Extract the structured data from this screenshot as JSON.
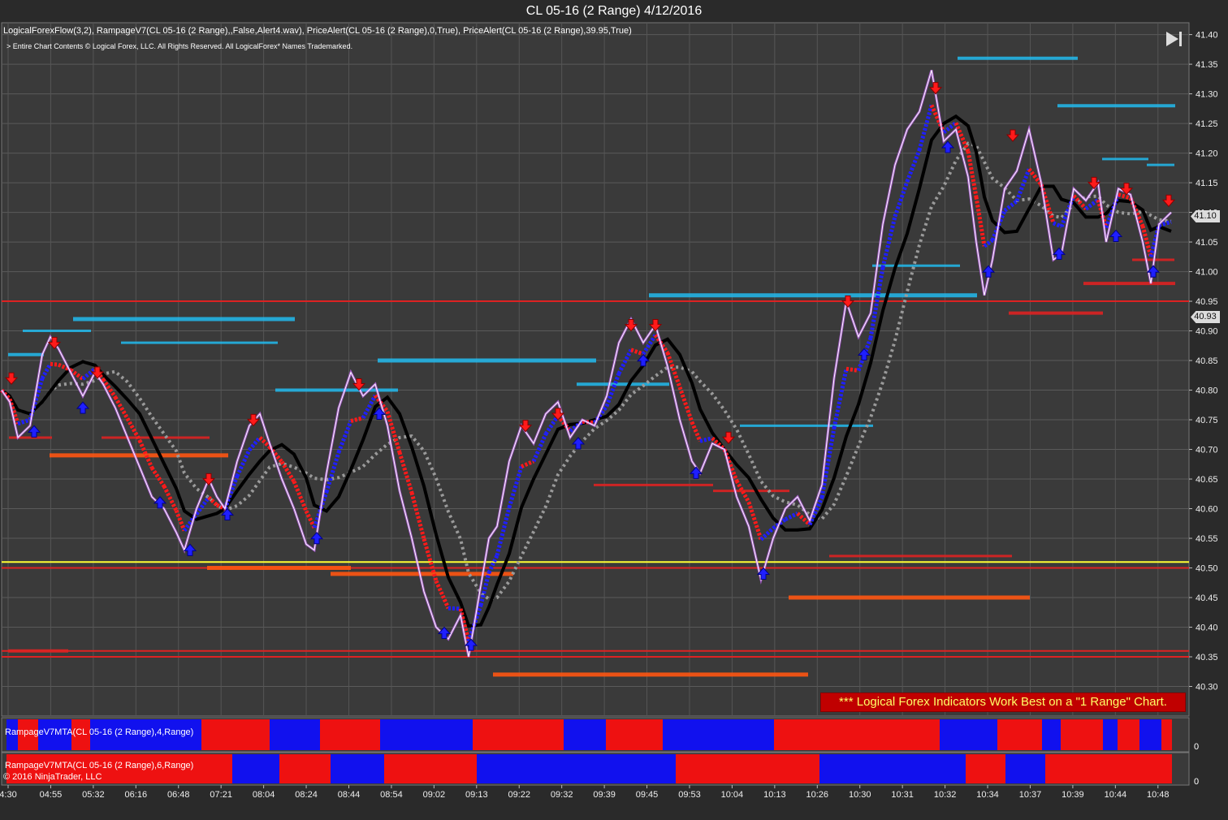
{
  "title": "CL 05-16 (2 Range)  4/12/2016",
  "indicators_line": "LogicalForexFlow(3,2),  RampageV7(CL 05-16 (2 Range),,False,Alert4.wav), PriceAlert(CL 05-16 (2 Range),0,True), PriceAlert(CL 05-16 (2 Range),39.95,True)",
  "copyright_line": "> Entire Chart Contents © Logical Forex, LLC. All Rights Reserved. All LogicalForex* Names Trademarked.",
  "notice": "*** Logical Forex Indicators Work Best on a \"1 Range\" Chart.",
  "panel1_label": "RampageV7MTA(CL 05-16 (2 Range),4,Range)",
  "panel2_label": "RampageV7MTA(CL 05-16 (2 Range),6,Range)",
  "ninja_copyright": "© 2016 NinjaTrader, LLC",
  "last_price": "41.10",
  "alert_price": "40.93",
  "panel_zero": "0",
  "colors": {
    "background": "#3a3a3a",
    "up": "#1f1fff",
    "down": "#ff1a1a",
    "price": "#ffffff",
    "price_glow": "#cc66ff",
    "level_red": "#dd2222",
    "level_yellow": "#ffff33",
    "resistance_blue": "#22bbee",
    "support_orange": "#ff5511",
    "trend_black": "#000000",
    "trend_gray": "#9a9a9a"
  },
  "chart_data": {
    "type": "line",
    "title": "CL 05-16 (2 Range)  4/12/2016",
    "ylim": [
      40.25,
      41.42
    ],
    "yticks": [
      40.3,
      40.35,
      40.4,
      40.45,
      40.5,
      40.55,
      40.6,
      40.65,
      40.7,
      40.75,
      40.8,
      40.85,
      40.9,
      40.95,
      41.0,
      41.05,
      41.1,
      41.15,
      41.2,
      41.25,
      41.3,
      41.35,
      41.4
    ],
    "x_tick_labels": [
      "4:30",
      "04:55",
      "05:32",
      "06:16",
      "06:48",
      "07:21",
      "08:04",
      "08:24",
      "08:44",
      "08:54",
      "09:02",
      "09:13",
      "09:22",
      "09:32",
      "09:39",
      "09:45",
      "09:53",
      "10:04",
      "10:13",
      "10:26",
      "10:30",
      "10:31",
      "10:32",
      "10:34",
      "10:37",
      "10:39",
      "10:44",
      "10:48"
    ],
    "grid": true,
    "price_series": [
      [
        0,
        40.8
      ],
      [
        10,
        40.78
      ],
      [
        20,
        40.72
      ],
      [
        35,
        40.74
      ],
      [
        50,
        40.86
      ],
      [
        60,
        40.89
      ],
      [
        70,
        40.87
      ],
      [
        85,
        40.83
      ],
      [
        100,
        40.79
      ],
      [
        115,
        40.83
      ],
      [
        125,
        40.81
      ],
      [
        140,
        40.77
      ],
      [
        155,
        40.72
      ],
      [
        170,
        40.67
      ],
      [
        185,
        40.62
      ],
      [
        200,
        40.6
      ],
      [
        215,
        40.56
      ],
      [
        225,
        40.53
      ],
      [
        240,
        40.6
      ],
      [
        255,
        40.65
      ],
      [
        265,
        40.62
      ],
      [
        275,
        40.6
      ],
      [
        290,
        40.68
      ],
      [
        305,
        40.74
      ],
      [
        318,
        40.76
      ],
      [
        330,
        40.71
      ],
      [
        345,
        40.65
      ],
      [
        360,
        40.6
      ],
      [
        375,
        40.54
      ],
      [
        385,
        40.53
      ],
      [
        400,
        40.66
      ],
      [
        415,
        40.77
      ],
      [
        430,
        40.83
      ],
      [
        445,
        40.79
      ],
      [
        460,
        40.81
      ],
      [
        475,
        40.74
      ],
      [
        490,
        40.63
      ],
      [
        505,
        40.55
      ],
      [
        520,
        40.46
      ],
      [
        535,
        40.4
      ],
      [
        550,
        40.38
      ],
      [
        565,
        40.42
      ],
      [
        575,
        40.35
      ],
      [
        590,
        40.47
      ],
      [
        600,
        40.55
      ],
      [
        610,
        40.57
      ],
      [
        625,
        40.68
      ],
      [
        640,
        40.74
      ],
      [
        655,
        40.71
      ],
      [
        670,
        40.76
      ],
      [
        685,
        40.78
      ],
      [
        700,
        40.72
      ],
      [
        715,
        40.75
      ],
      [
        730,
        40.74
      ],
      [
        745,
        40.79
      ],
      [
        760,
        40.88
      ],
      [
        775,
        40.92
      ],
      [
        790,
        40.88
      ],
      [
        805,
        40.91
      ],
      [
        820,
        40.84
      ],
      [
        835,
        40.75
      ],
      [
        850,
        40.68
      ],
      [
        860,
        40.66
      ],
      [
        875,
        40.71
      ],
      [
        890,
        40.7
      ],
      [
        905,
        40.62
      ],
      [
        920,
        40.57
      ],
      [
        935,
        40.48
      ],
      [
        950,
        40.55
      ],
      [
        965,
        40.6
      ],
      [
        980,
        40.62
      ],
      [
        995,
        40.58
      ],
      [
        1010,
        40.64
      ],
      [
        1025,
        40.82
      ],
      [
        1040,
        40.95
      ],
      [
        1055,
        40.89
      ],
      [
        1070,
        40.93
      ],
      [
        1085,
        41.08
      ],
      [
        1100,
        41.18
      ],
      [
        1115,
        41.24
      ],
      [
        1130,
        41.27
      ],
      [
        1145,
        41.34
      ],
      [
        1160,
        41.22
      ],
      [
        1175,
        41.24
      ],
      [
        1190,
        41.16
      ],
      [
        1200,
        41.05
      ],
      [
        1210,
        40.96
      ],
      [
        1220,
        41.02
      ],
      [
        1235,
        41.14
      ],
      [
        1250,
        41.17
      ],
      [
        1265,
        41.24
      ],
      [
        1280,
        41.15
      ],
      [
        1295,
        41.02
      ],
      [
        1305,
        41.03
      ],
      [
        1320,
        41.14
      ],
      [
        1335,
        41.12
      ],
      [
        1350,
        41.15
      ],
      [
        1360,
        41.05
      ],
      [
        1375,
        41.14
      ],
      [
        1390,
        41.13
      ],
      [
        1405,
        41.05
      ],
      [
        1415,
        40.98
      ],
      [
        1425,
        41.08
      ],
      [
        1440,
        41.1
      ]
    ],
    "price_levels": [
      {
        "price": 40.95,
        "color": "red"
      },
      {
        "price": 40.51,
        "color": "yellow"
      },
      {
        "price": 40.5,
        "color": "red"
      },
      {
        "price": 40.36,
        "color": "red"
      },
      {
        "price": 40.35,
        "color": "red"
      }
    ],
    "resistance_segments": [
      {
        "x1": 1177,
        "x2": 1325,
        "price": 41.36,
        "w": 4
      },
      {
        "x1": 1300,
        "x2": 1445,
        "price": 41.28,
        "w": 4
      },
      {
        "x1": 1355,
        "x2": 1412,
        "price": 41.19,
        "w": 3
      },
      {
        "x1": 1410,
        "x2": 1444,
        "price": 41.18,
        "w": 3
      },
      {
        "x1": 1072,
        "x2": 1180,
        "price": 41.01,
        "w": 3
      },
      {
        "x1": 797,
        "x2": 1201,
        "price": 40.96,
        "w": 5
      },
      {
        "x1": 88,
        "x2": 361,
        "price": 40.92,
        "w": 5
      },
      {
        "x1": 26,
        "x2": 110,
        "price": 40.9,
        "w": 3
      },
      {
        "x1": 147,
        "x2": 340,
        "price": 40.88,
        "w": 3
      },
      {
        "x1": 8,
        "x2": 52,
        "price": 40.86,
        "w": 4
      },
      {
        "x1": 463,
        "x2": 732,
        "price": 40.85,
        "w": 5
      },
      {
        "x1": 708,
        "x2": 822,
        "price": 40.81,
        "w": 4
      },
      {
        "x1": 337,
        "x2": 488,
        "price": 40.8,
        "w": 4
      },
      {
        "x1": 909,
        "x2": 1073,
        "price": 40.74,
        "w": 3
      }
    ],
    "support_segments": [
      {
        "x1": 1240,
        "x2": 1356,
        "price": 40.93,
        "w": 4
      },
      {
        "x1": 1392,
        "x2": 1444,
        "price": 41.02,
        "w": 3
      },
      {
        "x1": 1332,
        "x2": 1445,
        "price": 40.98,
        "w": 4
      },
      {
        "x1": 9,
        "x2": 62,
        "price": 40.72,
        "w": 3
      },
      {
        "x1": 123,
        "x2": 256,
        "price": 40.72,
        "w": 3
      },
      {
        "x1": 59,
        "x2": 279,
        "price": 40.69,
        "w": 5
      },
      {
        "x1": 729,
        "x2": 876,
        "price": 40.64,
        "w": 3
      },
      {
        "x1": 876,
        "x2": 970,
        "price": 40.63,
        "w": 3
      },
      {
        "x1": 1019,
        "x2": 1244,
        "price": 40.52,
        "w": 3
      },
      {
        "x1": 253,
        "x2": 430,
        "price": 40.5,
        "w": 5
      },
      {
        "x1": 405,
        "x2": 630,
        "price": 40.49,
        "w": 5
      },
      {
        "x1": 969,
        "x2": 1266,
        "price": 40.45,
        "w": 5
      },
      {
        "x1": 8,
        "x2": 82,
        "price": 40.36,
        "w": 4
      },
      {
        "x1": 605,
        "x2": 993,
        "price": 40.32,
        "w": 5
      }
    ],
    "down_arrows": [
      [
        12,
        40.81
      ],
      [
        65,
        40.87
      ],
      [
        118,
        40.82
      ],
      [
        255,
        40.64
      ],
      [
        310,
        40.74
      ],
      [
        440,
        40.8
      ],
      [
        645,
        40.73
      ],
      [
        685,
        40.75
      ],
      [
        775,
        40.9
      ],
      [
        805,
        40.9
      ],
      [
        895,
        40.71
      ],
      [
        1042,
        40.94
      ],
      [
        1150,
        41.3
      ],
      [
        1245,
        41.22
      ],
      [
        1345,
        41.14
      ],
      [
        1385,
        41.13
      ],
      [
        1437,
        41.11
      ]
    ],
    "up_arrows": [
      [
        40,
        40.74
      ],
      [
        100,
        40.78
      ],
      [
        195,
        40.62
      ],
      [
        232,
        40.54
      ],
      [
        278,
        40.6
      ],
      [
        388,
        40.56
      ],
      [
        465,
        40.77
      ],
      [
        545,
        40.4
      ],
      [
        578,
        40.38
      ],
      [
        710,
        40.72
      ],
      [
        790,
        40.86
      ],
      [
        855,
        40.67
      ],
      [
        938,
        40.5
      ],
      [
        1062,
        40.87
      ],
      [
        1165,
        41.22
      ],
      [
        1215,
        41.01
      ],
      [
        1302,
        41.04
      ],
      [
        1372,
        41.07
      ],
      [
        1418,
        41.01
      ]
    ],
    "panel1_blocks": [
      [
        "b",
        8,
        22
      ],
      [
        "r",
        22,
        47
      ],
      [
        "b",
        47,
        88
      ],
      [
        "r",
        88,
        111
      ],
      [
        "b",
        111,
        248
      ],
      [
        "r",
        248,
        332
      ],
      [
        "b",
        332,
        394
      ],
      [
        "r",
        394,
        468
      ],
      [
        "b",
        468,
        582
      ],
      [
        "r",
        582,
        694
      ],
      [
        "b",
        694,
        746
      ],
      [
        "r",
        746,
        816
      ],
      [
        "b",
        816,
        953
      ],
      [
        "r",
        953,
        1157
      ],
      [
        "b",
        1157,
        1228
      ],
      [
        "r",
        1228,
        1283
      ],
      [
        "b",
        1283,
        1306
      ],
      [
        "r",
        1306,
        1358
      ],
      [
        "b",
        1358,
        1376
      ],
      [
        "r",
        1376,
        1403
      ],
      [
        "b",
        1403,
        1430
      ],
      [
        "r",
        1430,
        1443
      ]
    ],
    "panel2_blocks": [
      [
        "r",
        8,
        286
      ],
      [
        "b",
        286,
        344
      ],
      [
        "r",
        344,
        407
      ],
      [
        "b",
        407,
        473
      ],
      [
        "r",
        473,
        587
      ],
      [
        "b",
        587,
        832
      ],
      [
        "r",
        832,
        1009
      ],
      [
        "b",
        1009,
        1189
      ],
      [
        "r",
        1189,
        1238
      ],
      [
        "b",
        1238,
        1287
      ],
      [
        "r",
        1287,
        1443
      ]
    ]
  }
}
